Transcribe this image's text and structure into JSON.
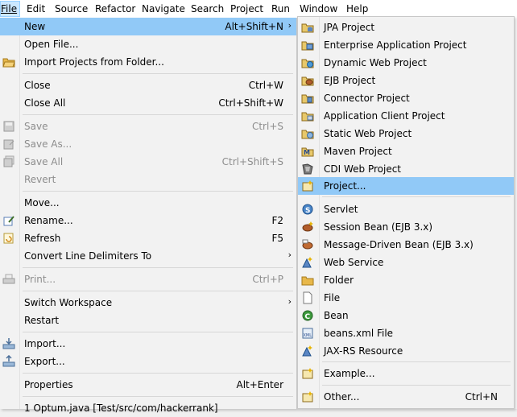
{
  "menubar": {
    "items": [
      {
        "label": "File"
      },
      {
        "label": "Edit"
      },
      {
        "label": "Source"
      },
      {
        "label": "Refactor"
      },
      {
        "label": "Navigate"
      },
      {
        "label": "Search"
      },
      {
        "label": "Project"
      },
      {
        "label": "Run"
      },
      {
        "label": "Window"
      },
      {
        "label": "Help"
      }
    ]
  },
  "file_menu": {
    "new": {
      "label": "New",
      "shortcut": "Alt+Shift+N",
      "icon": "none"
    },
    "open_file": {
      "label": "Open File..."
    },
    "import_projects": {
      "label": "Import Projects from Folder...",
      "icon": "folder-icon"
    },
    "close": {
      "label": "Close",
      "shortcut": "Ctrl+W"
    },
    "close_all": {
      "label": "Close All",
      "shortcut": "Ctrl+Shift+W"
    },
    "save": {
      "label": "Save",
      "shortcut": "Ctrl+S",
      "icon": "save-icon"
    },
    "save_as": {
      "label": "Save As...",
      "icon": "save-as-icon"
    },
    "save_all": {
      "label": "Save All",
      "shortcut": "Ctrl+Shift+S",
      "icon": "save-all-icon"
    },
    "revert": {
      "label": "Revert"
    },
    "move": {
      "label": "Move..."
    },
    "rename": {
      "label": "Rename...",
      "shortcut": "F2",
      "icon": "rename-icon"
    },
    "refresh": {
      "label": "Refresh",
      "shortcut": "F5",
      "icon": "refresh-icon"
    },
    "convert": {
      "label": "Convert Line Delimiters To"
    },
    "print": {
      "label": "Print...",
      "shortcut": "Ctrl+P",
      "icon": "print-icon"
    },
    "switch_workspace": {
      "label": "Switch Workspace"
    },
    "restart": {
      "label": "Restart"
    },
    "import": {
      "label": "Import...",
      "icon": "import-icon"
    },
    "export": {
      "label": "Export...",
      "icon": "export-icon"
    },
    "properties": {
      "label": "Properties",
      "shortcut": "Alt+Enter"
    },
    "recent": {
      "label": "1 Optum.java  [Test/src/com/hackerrank]"
    }
  },
  "new_submenu": {
    "items": [
      {
        "label": "JPA Project",
        "icon": "jpa-project-icon"
      },
      {
        "label": "Enterprise Application Project",
        "icon": "ear-project-icon"
      },
      {
        "label": "Dynamic Web Project",
        "icon": "dynamic-web-project-icon"
      },
      {
        "label": "EJB Project",
        "icon": "ejb-project-icon"
      },
      {
        "label": "Connector Project",
        "icon": "connector-project-icon"
      },
      {
        "label": "Application Client Project",
        "icon": "app-client-project-icon"
      },
      {
        "label": "Static Web Project",
        "icon": "static-web-project-icon"
      },
      {
        "label": "Maven Project",
        "icon": "maven-project-icon"
      },
      {
        "label": "CDI Web Project",
        "icon": "cdi-web-project-icon"
      },
      {
        "label": "Project...",
        "icon": "project-icon"
      },
      {
        "label": "Servlet",
        "icon": "servlet-icon"
      },
      {
        "label": "Session Bean (EJB 3.x)",
        "icon": "session-bean-icon"
      },
      {
        "label": "Message-Driven Bean (EJB 3.x)",
        "icon": "mdb-icon"
      },
      {
        "label": "Web Service",
        "icon": "web-service-icon"
      },
      {
        "label": "Folder",
        "icon": "folder-icon"
      },
      {
        "label": "File",
        "icon": "file-icon"
      },
      {
        "label": "Bean",
        "icon": "bean-icon"
      },
      {
        "label": "beans.xml File",
        "icon": "beans-xml-icon"
      },
      {
        "label": "JAX-RS Resource",
        "icon": "jaxrs-icon"
      },
      {
        "label": "Example...",
        "icon": "example-icon"
      },
      {
        "label": "Other...",
        "shortcut": "Ctrl+N",
        "icon": "other-icon"
      }
    ]
  },
  "colors": {
    "highlight": "#91c9f7",
    "menu_bg": "#f2f2f2",
    "disabled": "#8d8d8d"
  }
}
